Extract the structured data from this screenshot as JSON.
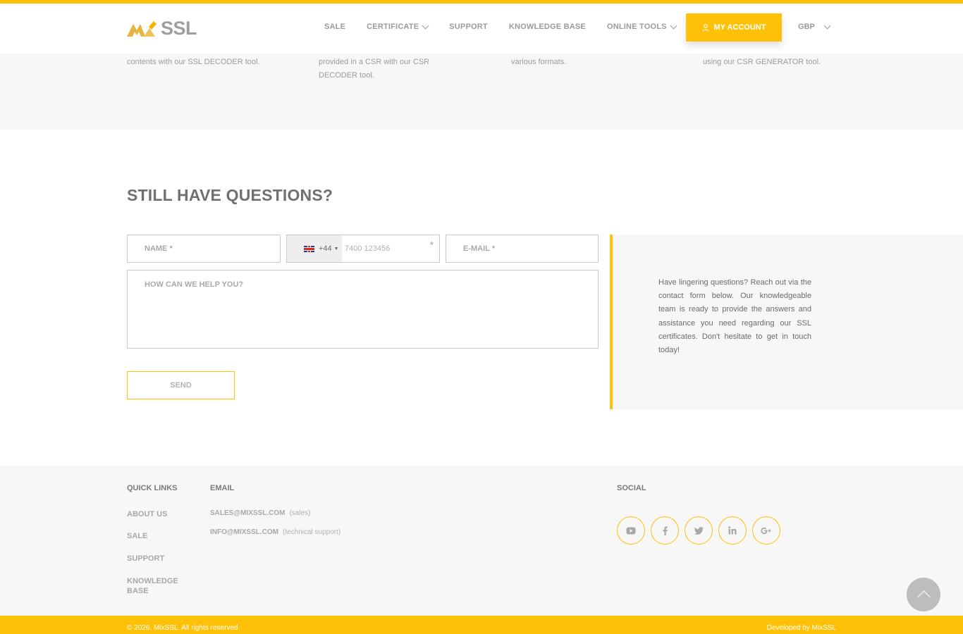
{
  "header": {
    "logo_text": "SSL",
    "logo_mark": "Mix",
    "nav": [
      {
        "label": "SALE",
        "has_dropdown": false
      },
      {
        "label": "CERTIFICATE",
        "has_dropdown": true
      },
      {
        "label": "SUPPORT",
        "has_dropdown": false
      },
      {
        "label": "KNOWLEDGE BASE",
        "has_dropdown": false
      },
      {
        "label": "ONLINE TOOLS",
        "has_dropdown": true
      }
    ],
    "account_label": "MY ACCOUNT",
    "currency": "GBP"
  },
  "tools": [
    {
      "text": "contents with our SSL DECODER tool."
    },
    {
      "text": "provided in a CSR with our CSR DECODER tool."
    },
    {
      "text": "various formats."
    },
    {
      "text": "using our CSR GENERATOR tool."
    }
  ],
  "questions": {
    "title": "STILL HAVE QUESTIONS?",
    "name_placeholder": "NAME *",
    "phone_prefix": "+44",
    "phone_placeholder": "7400 123456",
    "required_mark": "*",
    "email_placeholder": "E-MAIL *",
    "message_placeholder": "HOW CAN WE HELP YOU?",
    "send_label": "SEND",
    "info_text": "Have lingering questions? Reach out via the contact form below. Our knowledgeable team is ready to provide the answers and assistance you need regarding our SSL certificates. Don't hesitate to get in touch today!"
  },
  "footer": {
    "quick_links_title": "QUICK LINKS",
    "quick_links": [
      "ABOUT US",
      "SALE",
      "SUPPORT",
      "KNOWLEDGE BASE"
    ],
    "email_title": "EMAIL",
    "emails": [
      {
        "address": "SALES@MIXSSL.COM",
        "note": "(sales)"
      },
      {
        "address": "INFO@MIXSSL.COM",
        "note": "(technical support)"
      }
    ],
    "social_title": "SOCIAL",
    "social": [
      "youtube-icon",
      "facebook-icon",
      "twitter-icon",
      "linkedin-icon",
      "google-plus-icon"
    ],
    "copyright": "© 2026, MixSSL. All rights reserved",
    "developed_by": "Developed by MixSSL"
  },
  "colors": {
    "accent": "#ffc107",
    "panel_bg": "#f7f7f7"
  }
}
